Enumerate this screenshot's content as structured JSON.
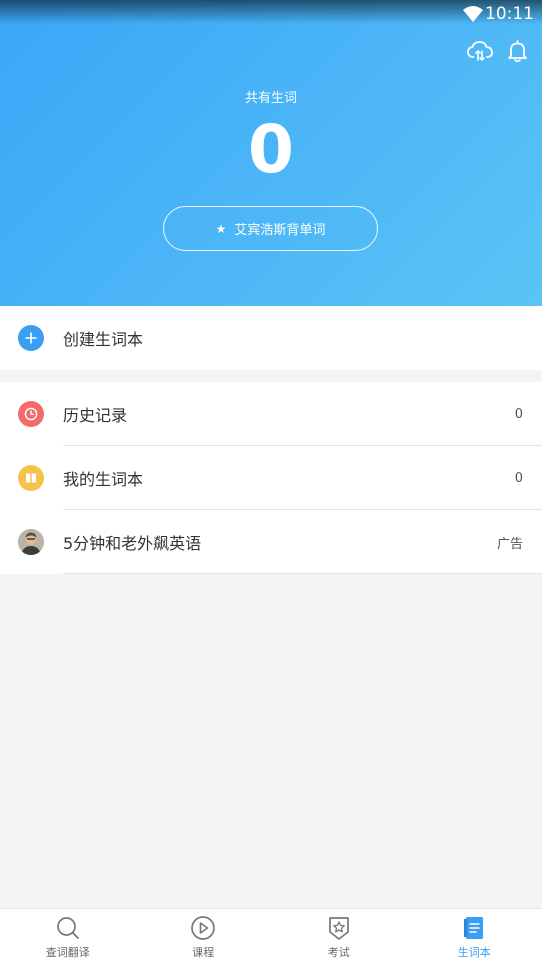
{
  "status_bar": {
    "time": "10:11",
    "wifi_icon": "wifi-icon"
  },
  "header": {
    "cloud_icon": "cloud-sync-icon",
    "bell_icon": "bell-icon",
    "word_count_label": "共有生词",
    "word_count": "0",
    "recite_button_label": "艾宾浩斯背单词",
    "gradient": [
      "#3aa6f7",
      "#5bc4f5"
    ]
  },
  "create_row": {
    "label": "创建生词本",
    "icon": "plus-icon",
    "icon_color": "#3a9ef3"
  },
  "list": [
    {
      "label": "历史记录",
      "value": "0",
      "icon": "clock-icon",
      "icon_color": "#f26b6b"
    },
    {
      "label": "我的生词本",
      "value": "0",
      "icon": "book-icon",
      "icon_color": "#f4c34a"
    },
    {
      "label": "5分钟和老外飙英语",
      "value": "广告",
      "icon": "avatar"
    }
  ],
  "bottom_nav": {
    "items": [
      {
        "label": "查词翻译",
        "icon": "search-icon"
      },
      {
        "label": "课程",
        "icon": "play-icon"
      },
      {
        "label": "考试",
        "icon": "star-badge-icon"
      },
      {
        "label": "生词本",
        "icon": "notebook-icon",
        "active": true
      }
    ],
    "active_color": "#3a9ef3"
  }
}
